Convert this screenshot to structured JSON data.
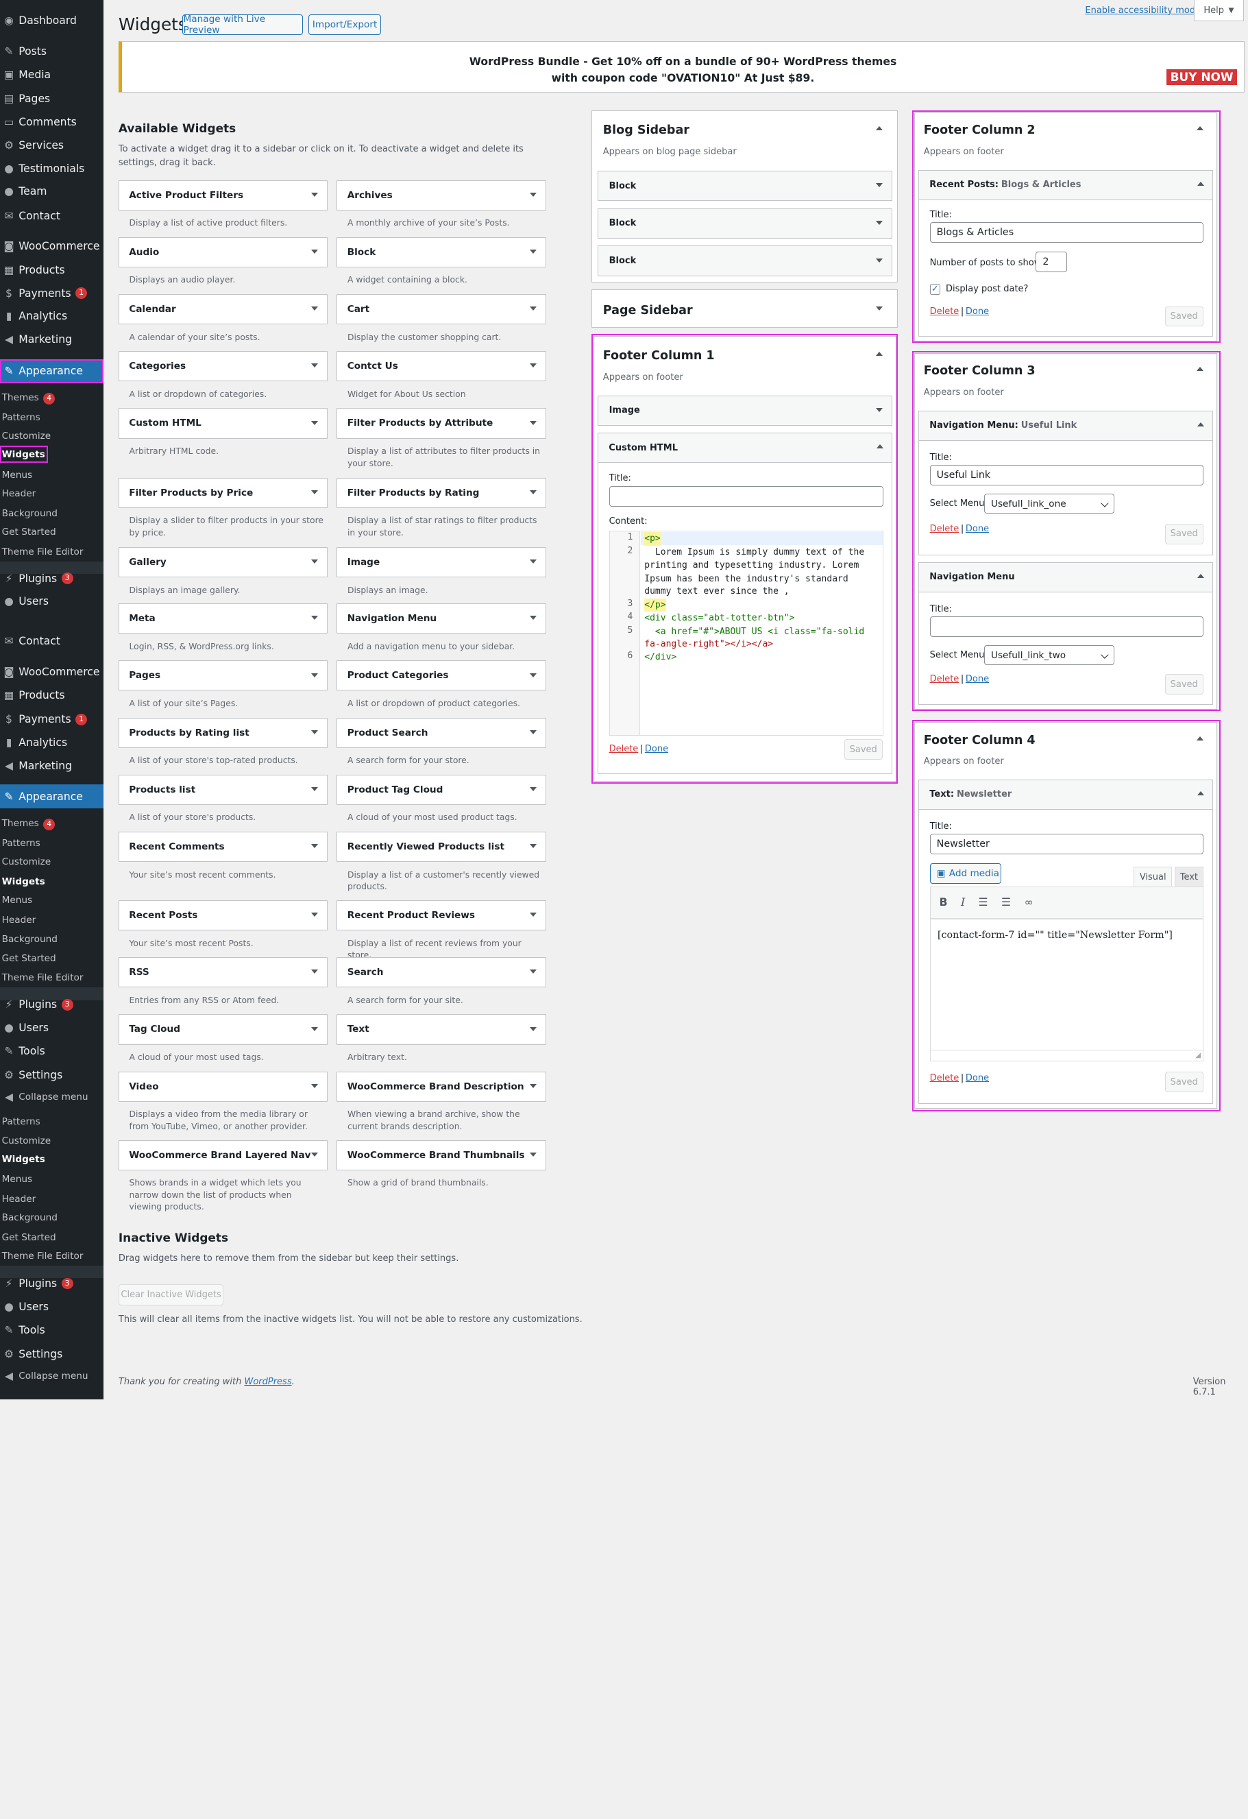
{
  "menu": {
    "dashboard": "Dashboard",
    "posts": "Posts",
    "media": "Media",
    "pages": "Pages",
    "comments": "Comments",
    "services": "Services",
    "testimonials": "Testimonials",
    "team": "Team",
    "contact": "Contact",
    "woocommerce": "WooCommerce",
    "products": "Products",
    "payments": "Payments",
    "payments_badge": "1",
    "analytics": "Analytics",
    "marketing": "Marketing",
    "appearance": "Appearance",
    "themes": "Themes",
    "themes_badge": "4",
    "patterns": "Patterns",
    "customize": "Customize",
    "widgets": "Widgets",
    "menus": "Menus",
    "header": "Header",
    "background": "Background",
    "get_started": "Get Started",
    "theme_file_editor": "Theme File Editor",
    "plugins": "Plugins",
    "plugins_badge": "3",
    "users": "Users",
    "tools": "Tools",
    "settings": "Settings",
    "collapse": "Collapse menu"
  },
  "topbar": {
    "accessibility": "Enable accessibility mode",
    "help": "Help"
  },
  "header": {
    "title": "Widgets",
    "live_preview": "Manage with Live Preview",
    "import_export": "Import/Export"
  },
  "banner": {
    "line1": "WordPress Bundle - Get 10% off on a bundle of 90+ WordPress themes",
    "line2": "with coupon code \"OVATION10\" At Just $89.",
    "buy_now": "BUY NOW"
  },
  "available": {
    "title": "Available Widgets",
    "desc": "To activate a widget drag it to a sidebar or click on it. To deactivate a widget and delete its settings, drag it back."
  },
  "widgets": [
    {
      "name": "Active Product Filters",
      "desc": "Display a list of active product filters."
    },
    {
      "name": "Archives",
      "desc": "A monthly archive of your site’s Posts."
    },
    {
      "name": "Audio",
      "desc": "Displays an audio player."
    },
    {
      "name": "Block",
      "desc": "A widget containing a block."
    },
    {
      "name": "Calendar",
      "desc": "A calendar of your site’s posts."
    },
    {
      "name": "Cart",
      "desc": "Display the customer shopping cart."
    },
    {
      "name": "Categories",
      "desc": "A list or dropdown of categories."
    },
    {
      "name": "Contct Us",
      "desc": "Widget for About Us section"
    },
    {
      "name": "Custom HTML",
      "desc": "Arbitrary HTML code."
    },
    {
      "name": "Filter Products by Attribute",
      "desc": "Display a list of attributes to filter products in your store."
    },
    {
      "name": "Filter Products by Price",
      "desc": "Display a slider to filter products in your store by price."
    },
    {
      "name": "Filter Products by Rating",
      "desc": "Display a list of star ratings to filter products in your store."
    },
    {
      "name": "Gallery",
      "desc": "Displays an image gallery."
    },
    {
      "name": "Image",
      "desc": "Displays an image."
    },
    {
      "name": "Meta",
      "desc": "Login, RSS, & WordPress.org links."
    },
    {
      "name": "Navigation Menu",
      "desc": "Add a navigation menu to your sidebar."
    },
    {
      "name": "Pages",
      "desc": "A list of your site’s Pages."
    },
    {
      "name": "Product Categories",
      "desc": "A list or dropdown of product categories."
    },
    {
      "name": "Products by Rating list",
      "desc": "A list of your store's top-rated products."
    },
    {
      "name": "Product Search",
      "desc": "A search form for your store."
    },
    {
      "name": "Products list",
      "desc": "A list of your store's products."
    },
    {
      "name": "Product Tag Cloud",
      "desc": "A cloud of your most used product tags."
    },
    {
      "name": "Recent Comments",
      "desc": "Your site’s most recent comments."
    },
    {
      "name": "Recently Viewed Products list",
      "desc": "Display a list of a customer's recently viewed products."
    },
    {
      "name": "Recent Posts",
      "desc": "Your site’s most recent Posts."
    },
    {
      "name": "Recent Product Reviews",
      "desc": "Display a list of recent reviews from your store."
    },
    {
      "name": "RSS",
      "desc": "Entries from any RSS or Atom feed."
    },
    {
      "name": "Search",
      "desc": "A search form for your site."
    },
    {
      "name": "Tag Cloud",
      "desc": "A cloud of your most used tags."
    },
    {
      "name": "Text",
      "desc": "Arbitrary text."
    },
    {
      "name": "Video",
      "desc": "Displays a video from the media library or from YouTube, Vimeo, or another provider."
    },
    {
      "name": "WooCommerce Brand Description",
      "desc": "When viewing a brand archive, show the current brands description."
    },
    {
      "name": "WooCommerce Brand Layered Nav",
      "desc": "Shows brands in a widget which lets you narrow down the list of products when viewing products."
    },
    {
      "name": "WooCommerce Brand Thumbnails",
      "desc": "Show a grid of brand thumbnails."
    }
  ],
  "inactive": {
    "title": "Inactive Widgets",
    "desc": "Drag widgets here to remove them from the sidebar but keep their settings.",
    "clear": "Clear Inactive Widgets",
    "note": "This will clear all items from the inactive widgets list. You will not be able to restore any customizations."
  },
  "footer": {
    "thanks": "Thank you for creating with ",
    "wp": "WordPress",
    "version": "Version 6.7.1"
  },
  "common": {
    "title_label": "Title:",
    "content_label": "Content:",
    "delete": "Delete",
    "done": "Done",
    "saved": "Saved",
    "appears_footer": "Appears on footer",
    "select_menu": "Select Menu:"
  },
  "blog_sidebar": {
    "title": "Blog Sidebar",
    "desc": "Appears on blog page sidebar",
    "block": "Block"
  },
  "page_sidebar": {
    "title": "Page Sidebar"
  },
  "fc1": {
    "title": "Footer Column 1",
    "image": "Image",
    "custom_html": "Custom HTML",
    "title_value": "",
    "code": [
      "<p>",
      "  Lorem Ipsum is simply dummy text of the",
      "printing and typesetting industry. Lorem",
      "Ipsum has been the industry's standard",
      "dummy text ever since the ,",
      "</p>",
      "<div class=\"abt-totter-btn\">",
      "  <a href=\"#\">ABOUT US <i class=\"fa-solid",
      "fa-angle-right\"></i></a>",
      "</div>"
    ],
    "line_numbers": [
      "1",
      "2",
      "3",
      "4",
      "5",
      "6"
    ]
  },
  "fc2": {
    "title": "Footer Column 2",
    "widget": "Recent Posts:",
    "widget_sub": "Blogs & Articles",
    "title_value": "Blogs & Articles",
    "num_label": "Number of posts to show:",
    "num_value": "2",
    "date_label": "Display post date?"
  },
  "fc3": {
    "title": "Footer Column 3",
    "nav1": "Navigation Menu:",
    "nav1_sub": "Useful Link",
    "title1": "Useful Link",
    "menu1": "Usefull_link_one",
    "nav2": "Navigation Menu",
    "title2": "",
    "menu2": "Usefull_link_two"
  },
  "fc4": {
    "title": "Footer Column 4",
    "widget": "Text:",
    "widget_sub": "Newsletter",
    "title_value": "Newsletter",
    "add_media": "Add media",
    "visual": "Visual",
    "text": "Text",
    "content": "[contact-form-7 id=\"\" title=\"Newsletter Form\"]"
  },
  "colors": {
    "accent": "#2271b1",
    "highlight": "#e02be0",
    "sidebar_bg": "#1d2327",
    "danger": "#d63638"
  }
}
